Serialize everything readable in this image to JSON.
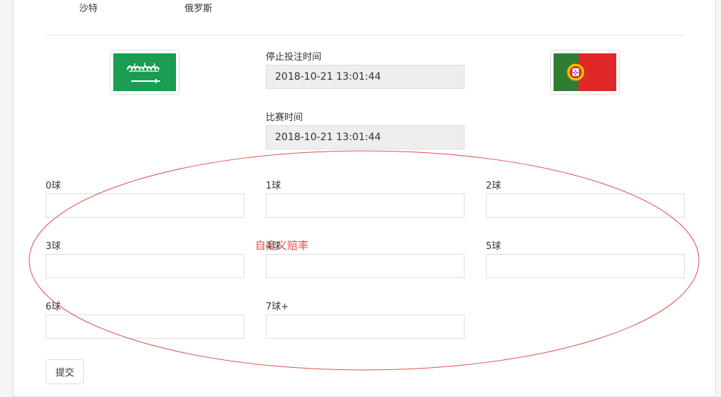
{
  "teams": {
    "home_name": "沙特",
    "away_name": "俄罗斯"
  },
  "flags": {
    "home_icon": "saudi-arabia-flag-icon",
    "away_icon": "portugal-flag-icon"
  },
  "betting_close": {
    "label": "停止投注时间",
    "value": "2018-10-21 13:01:44"
  },
  "match_time": {
    "label": "比赛时间",
    "value": "2018-10-21 13:01:44"
  },
  "odds_fields": [
    {
      "label": "0球",
      "value": ""
    },
    {
      "label": "1球",
      "value": ""
    },
    {
      "label": "2球",
      "value": ""
    },
    {
      "label": "3球",
      "value": ""
    },
    {
      "label": "4球",
      "value": ""
    },
    {
      "label": "5球",
      "value": ""
    },
    {
      "label": "6球",
      "value": ""
    },
    {
      "label": "7球+",
      "value": ""
    }
  ],
  "submit_label": "提交",
  "annotation": {
    "text": "自定义赔率",
    "color": "#d9534f"
  },
  "colors": {
    "saudi_green": "#1a9c52",
    "portugal_green": "#2e7d32",
    "portugal_red": "#e02828"
  }
}
